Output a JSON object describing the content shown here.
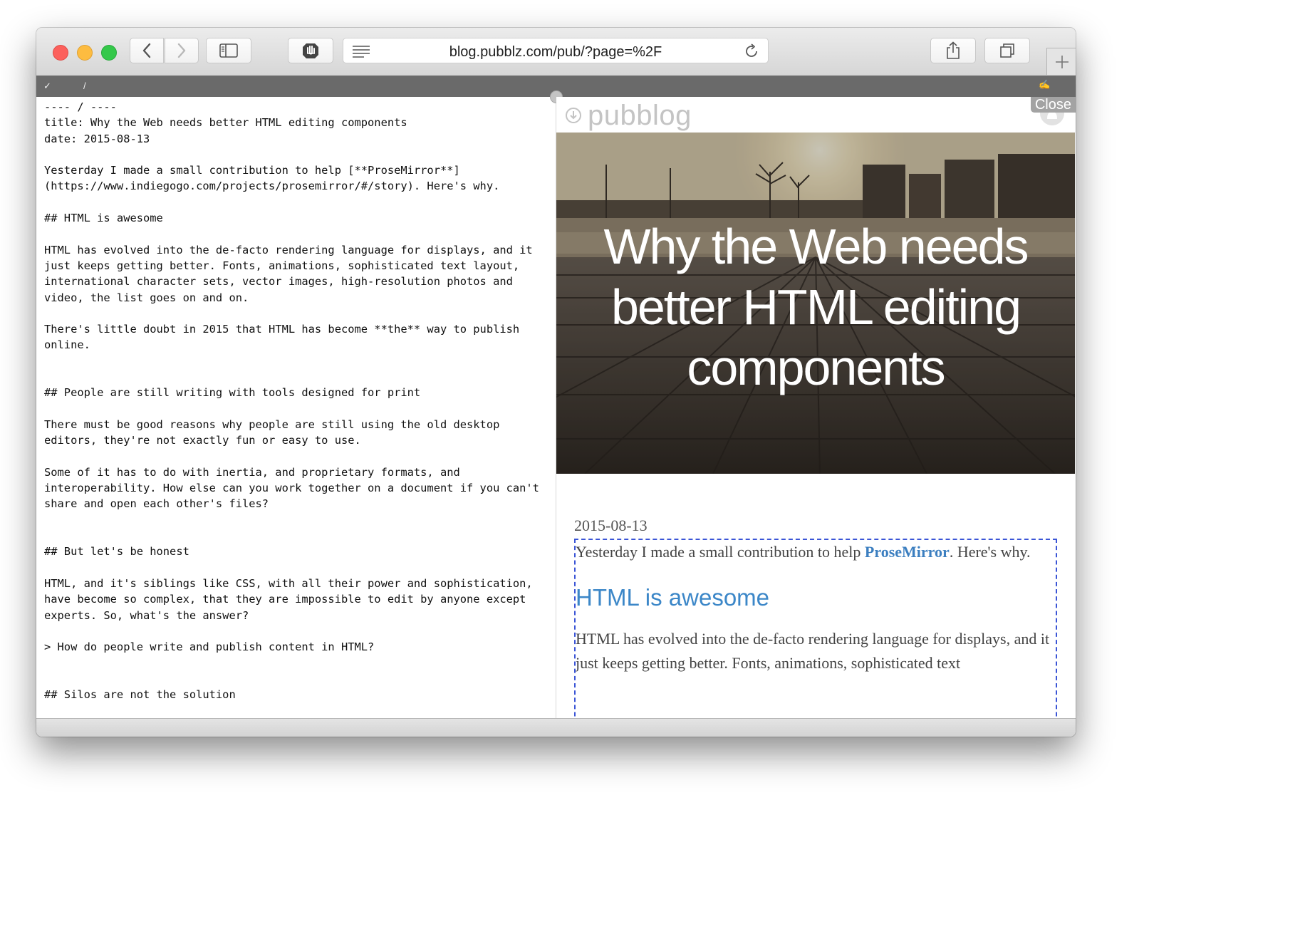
{
  "browser": {
    "url": "blog.pubblz.com/pub/?page=%2F"
  },
  "editor_bar": {
    "check": "✓",
    "slash": "/",
    "edit_glyph": "✍"
  },
  "editor": {
    "lines": [
      "---- / ----",
      "title: Why the Web needs better HTML editing components",
      "date: 2015-08-13",
      "",
      "Yesterday I made a small contribution to help [**ProseMirror**]",
      "(https://www.indiegogo.com/projects/prosemirror/#/story). Here's why.",
      "",
      "## HTML is awesome",
      "",
      "HTML has evolved into the de-facto rendering language for displays, and it",
      "just keeps getting better. Fonts, animations, sophisticated text layout,",
      "international character sets, vector images, high-resolution photos and",
      "video, the list goes on and on.",
      "",
      "There's little doubt in 2015 that HTML has become **the** way to publish",
      "online.",
      "",
      "",
      "## People are still writing with tools designed for print",
      "",
      "There must be good reasons why people are still using the old desktop",
      "editors, they're not exactly fun or easy to use.",
      "",
      "Some of it has to do with inertia, and proprietary formats, and",
      "interoperability. How else can you work together on a document if you can't",
      "share and open each other's files?",
      "",
      "",
      "## But let's be honest",
      "",
      "HTML, and it's siblings like CSS, with all their power and sophistication,",
      "have become so complex, that they are impossible to edit by anyone except",
      "experts. So, what's the answer?",
      "",
      "> How do people write and publish content in HTML?",
      "",
      "",
      "## Silos are not the solution"
    ]
  },
  "preview": {
    "brand": "pubblog",
    "close_label": "Close",
    "hero_title": "Why the Web needs better HTML editing components",
    "date": "2015-08-13",
    "intro_before": "Yesterday I made a small contribution to help ",
    "intro_link": "ProseMirror",
    "intro_after": ". Here's why.",
    "heading": "HTML is awesome",
    "para": "HTML has evolved into the de-facto rendering language for displays, and it just keeps getting better. Fonts, animations, sophisticated text"
  },
  "colors": {
    "link": "#3c7fc0",
    "heading": "#3c87c8",
    "selection_border": "#3b55d6"
  }
}
